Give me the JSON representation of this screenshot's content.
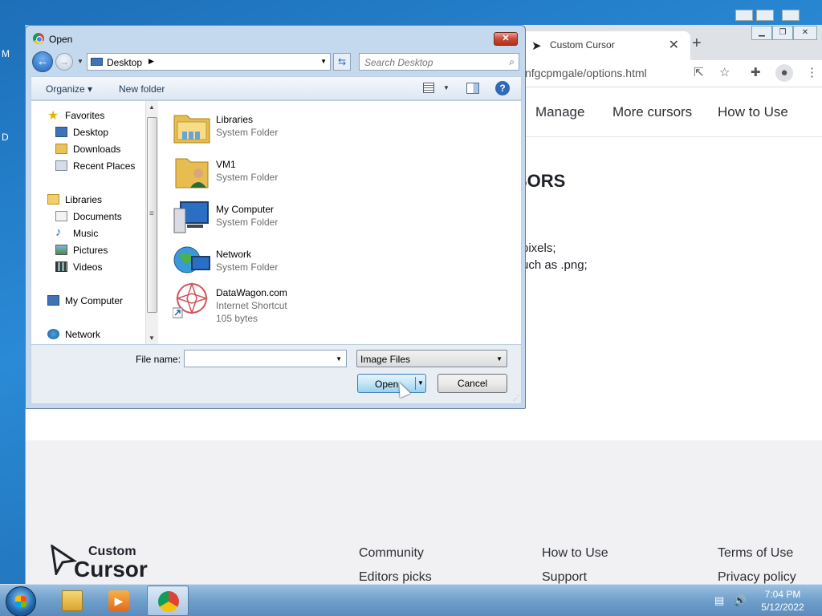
{
  "browser": {
    "tab_title": "Custom Cursor",
    "tab_close": "✕",
    "new_tab": "+",
    "url": "nfgcpmgale/options.html",
    "nav": [
      "Manage",
      "More cursors",
      "How to Use"
    ],
    "heading": "SORS",
    "lines": [
      "pixels;",
      "uch as .png;"
    ],
    "footer": {
      "logo_top": "Custom",
      "logo_bottom": "Cursor",
      "col1": [
        "Community",
        "Editors picks"
      ],
      "col2": [
        "How to Use",
        "Support"
      ],
      "col3": [
        "Terms of Use",
        "Privacy policy"
      ]
    }
  },
  "dialog": {
    "title": "Open",
    "close": "✕",
    "address": "Desktop",
    "search_placeholder": "Search Desktop",
    "toolbar": {
      "organize": "Organize ▾",
      "new_folder": "New folder"
    },
    "tree": [
      {
        "label": "Favorites",
        "icon": "star-icon"
      },
      {
        "label": "Desktop",
        "icon": "desktop-icon"
      },
      {
        "label": "Downloads",
        "icon": "downloads-icon"
      },
      {
        "label": "Recent Places",
        "icon": "recent-places-icon"
      },
      {
        "label": "Libraries",
        "icon": "libraries-icon"
      },
      {
        "label": "Documents",
        "icon": "documents-icon"
      },
      {
        "label": "Music",
        "icon": "music-icon"
      },
      {
        "label": "Pictures",
        "icon": "pictures-icon"
      },
      {
        "label": "Videos",
        "icon": "videos-icon"
      },
      {
        "label": "My Computer",
        "icon": "computer-icon"
      },
      {
        "label": "Network",
        "icon": "network-icon"
      }
    ],
    "files": [
      {
        "name": "Libraries",
        "type": "System Folder",
        "icon": "libraries-folder-icon"
      },
      {
        "name": "VM1",
        "type": "System Folder",
        "icon": "user-folder-icon"
      },
      {
        "name": "My Computer",
        "type": "System Folder",
        "icon": "computer-icon"
      },
      {
        "name": "Network",
        "type": "System Folder",
        "icon": "network-globe-icon"
      },
      {
        "name": "DataWagon.com",
        "type": "Internet Shortcut",
        "size": "105 bytes",
        "icon": "shortcut-icon"
      }
    ],
    "file_name_label": "File name:",
    "file_name_value": "",
    "file_type": "Image Files",
    "open_label": "Open",
    "cancel_label": "Cancel"
  },
  "taskbar": {
    "time": "7:04 PM",
    "date": "5/12/2022"
  },
  "desktop_letters": [
    "M",
    "D"
  ]
}
